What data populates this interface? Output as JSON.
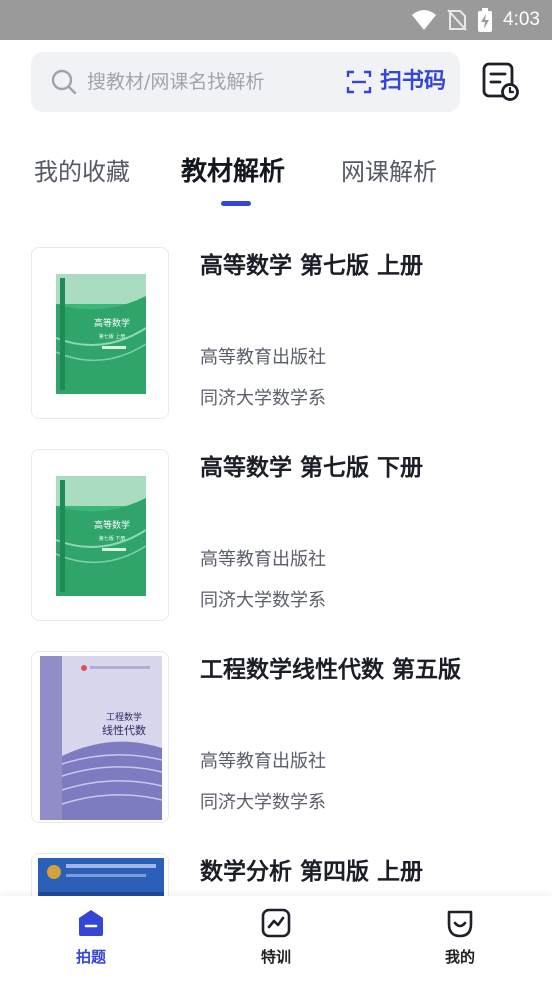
{
  "status_bar": {
    "time": "4:03"
  },
  "search": {
    "placeholder": "搜教材/网课名找解析",
    "scan_label": "扫书码"
  },
  "tabs": [
    {
      "label": "我的收藏",
      "active": false
    },
    {
      "label": "教材解析",
      "active": true
    },
    {
      "label": "网课解析",
      "active": false
    }
  ],
  "books": [
    {
      "title": "高等数学 第七版 上册",
      "publisher": "高等教育出版社",
      "author": "同济大学数学系",
      "cover_title": "高等数学",
      "cover_sub": "第七版 上册"
    },
    {
      "title": "高等数学 第七版 下册",
      "publisher": "高等教育出版社",
      "author": "同济大学数学系",
      "cover_title": "高等数学",
      "cover_sub": "第七版 下册"
    },
    {
      "title": "工程数学线性代数 第五版",
      "publisher": "高等教育出版社",
      "author": "同济大学数学系",
      "cover_title": "工程数学",
      "cover_sub": "线性代数"
    },
    {
      "title": "数学分析 第四版 上册",
      "publisher": "",
      "author": "",
      "cover_title": "",
      "cover_sub": ""
    }
  ],
  "bottom_nav": [
    {
      "label": "拍题",
      "active": true,
      "icon": "photo-question-icon"
    },
    {
      "label": "特训",
      "active": false,
      "icon": "training-chart-icon"
    },
    {
      "label": "我的",
      "active": false,
      "icon": "smile-profile-icon"
    }
  ],
  "colors": {
    "accent": "#3545d8",
    "cover_green": "#2fb36f",
    "cover_purple": "#8f8ec9",
    "cover_blue": "#1f4a9c"
  }
}
